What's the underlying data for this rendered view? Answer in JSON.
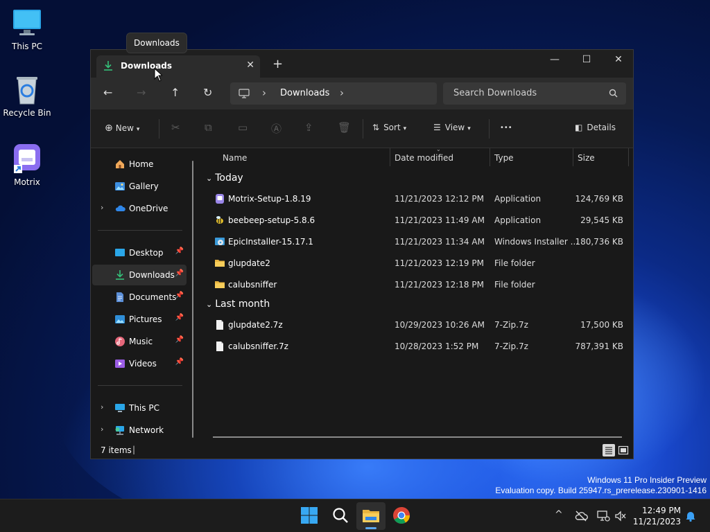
{
  "desktop": {
    "icons": [
      {
        "label": "This PC"
      },
      {
        "label": "Recycle Bin"
      },
      {
        "label": "Motrix"
      }
    ],
    "watermark_line1": "Windows 11 Pro Insider Preview",
    "watermark_line2": "Evaluation copy. Build 25947.rs_prerelease.230901-1416"
  },
  "tooltip": "Downloads",
  "window": {
    "tab_label": "Downloads",
    "tab_close": "✕",
    "new_tab": "+",
    "controls": {
      "minimize": "—",
      "maximize": "☐",
      "close": "✕"
    },
    "nav": {
      "back": "←",
      "forward": "→",
      "up": "↑",
      "refresh": "↻"
    },
    "address": {
      "crumb": "Downloads",
      "sep": "›"
    },
    "search_placeholder": "Search Downloads",
    "toolbar": {
      "new_label": "New",
      "sort_label": "Sort",
      "view_label": "View",
      "more": "•••",
      "details_label": "Details"
    },
    "sidebar": {
      "top": [
        {
          "label": "Home"
        },
        {
          "label": "Gallery"
        },
        {
          "label": "OneDrive"
        }
      ],
      "pinned": [
        {
          "label": "Desktop"
        },
        {
          "label": "Downloads"
        },
        {
          "label": "Documents"
        },
        {
          "label": "Pictures"
        },
        {
          "label": "Music"
        },
        {
          "label": "Videos"
        }
      ],
      "bottom": [
        {
          "label": "This PC"
        },
        {
          "label": "Network"
        }
      ]
    },
    "columns": {
      "name": "Name",
      "date": "Date modified",
      "type": "Type",
      "size": "Size"
    },
    "groups": [
      {
        "label": "Today",
        "files": [
          {
            "name": "Motrix-Setup-1.8.19",
            "date": "11/21/2023 12:12 PM",
            "type": "Application",
            "size": "124,769 KB"
          },
          {
            "name": "beebeep-setup-5.8.6",
            "date": "11/21/2023 11:49 AM",
            "type": "Application",
            "size": "29,545 KB"
          },
          {
            "name": "EpicInstaller-15.17.1",
            "date": "11/21/2023 11:34 AM",
            "type": "Windows Installer ...",
            "size": "180,736 KB"
          },
          {
            "name": "glupdate2",
            "date": "11/21/2023 12:19 PM",
            "type": "File folder",
            "size": ""
          },
          {
            "name": "calubsniffer",
            "date": "11/21/2023 12:18 PM",
            "type": "File folder",
            "size": ""
          }
        ]
      },
      {
        "label": "Last month",
        "files": [
          {
            "name": "glupdate2.7z",
            "date": "10/29/2023 10:26 AM",
            "type": "7-Zip.7z",
            "size": "17,500 KB"
          },
          {
            "name": "calubsniffer.7z",
            "date": "10/28/2023 1:52 PM",
            "type": "7-Zip.7z",
            "size": "787,391 KB"
          }
        ]
      }
    ],
    "status_text": "7 items",
    "status_sep": "|"
  },
  "taskbar": {
    "time": "12:49 PM",
    "date": "11/21/2023",
    "overflow": "^"
  }
}
